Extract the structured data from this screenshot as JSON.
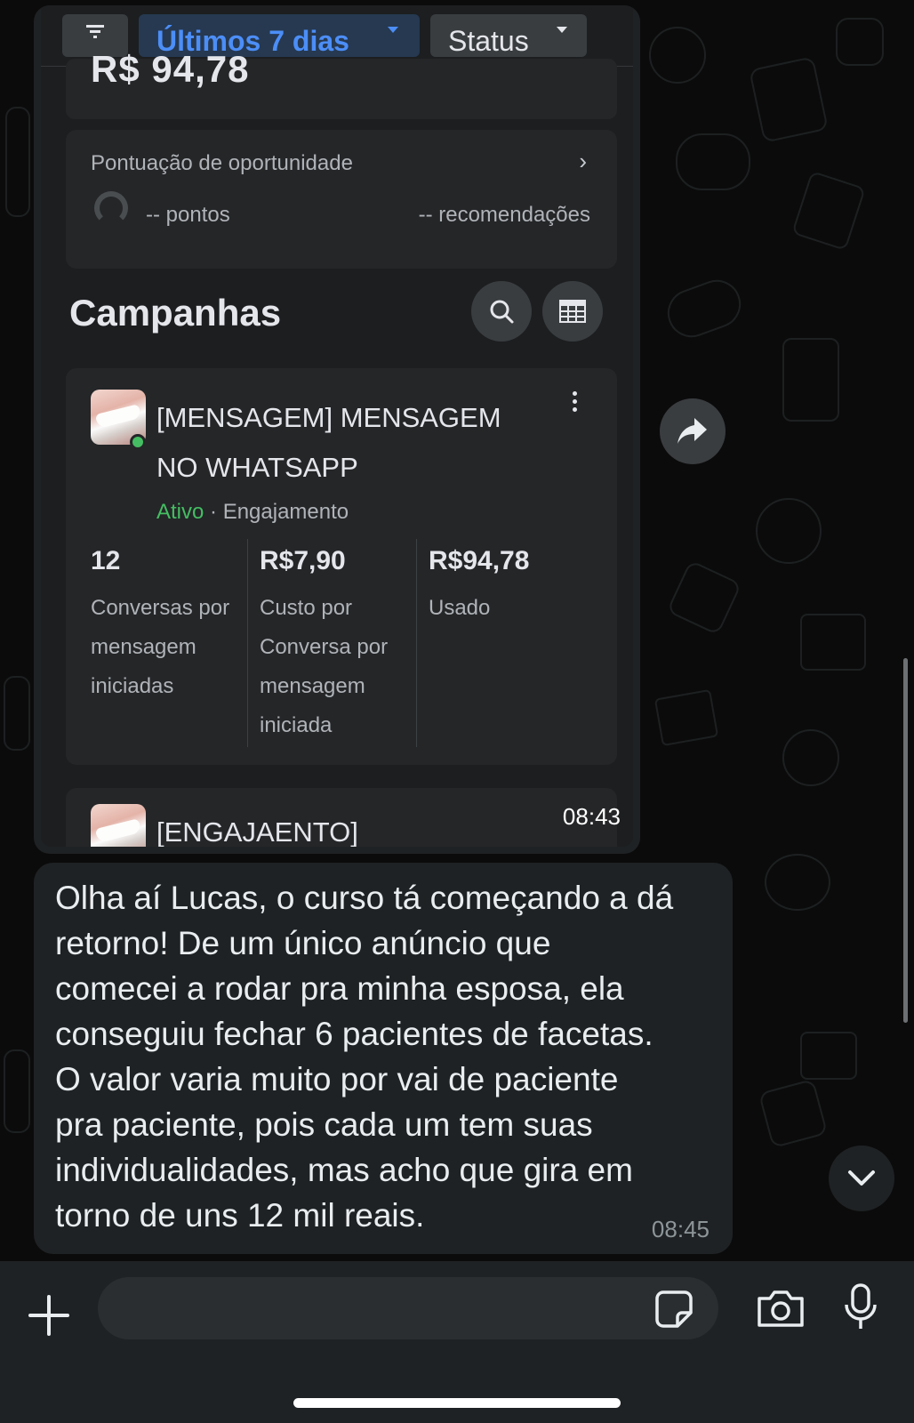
{
  "image_message": {
    "filters": {
      "date_range": "Últimos 7 dias",
      "status": "Status"
    },
    "amount_spent": "R$ 94,78",
    "opportunity": {
      "title": "Pontuação de oportunidade",
      "points": "-- pontos",
      "recommendations": "-- recomendações"
    },
    "campaigns_title": "Campanhas",
    "campaign": {
      "name": "[MENSAGEM] MENSAGEM NO WHATSAPP",
      "status": "Ativo",
      "separator": "·",
      "objective": "Engajamento",
      "metrics": [
        {
          "value": "12",
          "label": "Conversas por mensagem iniciadas"
        },
        {
          "value": "R$7,90",
          "label": "Custo por Conversa por mensagem iniciada"
        },
        {
          "value": "R$94,78",
          "label": "Usado"
        }
      ]
    },
    "next_campaign_name": "[ENGAJAENTO]",
    "time": "08:43"
  },
  "text_message": {
    "text": "Olha aí Lucas, o curso tá começando a dá\nretorno! De um único anúncio que\ncomecei a rodar pra minha esposa, ela\nconseguiu fechar 6 pacientes de facetas.\nO valor varia muito por vai de paciente\npra paciente, pois cada um tem suas\nindividualidades, mas acho que gira em\ntorno de uns 12 mil reais.",
    "time": "08:45"
  },
  "input": {
    "placeholder": "",
    "value": ""
  },
  "icons": {
    "filter": "filter-icon",
    "search": "search-icon",
    "table": "table-icon",
    "forward": "forward-icon",
    "more": "more-vertical-icon",
    "scroll_down": "chevron-down-icon",
    "plus": "plus-icon",
    "sticker": "sticker-icon",
    "camera": "camera-icon",
    "mic": "microphone-icon"
  },
  "colors": {
    "active_status": "#45bd62",
    "filter_accent": "#4c8ef7",
    "bubble": "#1f2224",
    "background": "#0b0b0b"
  }
}
